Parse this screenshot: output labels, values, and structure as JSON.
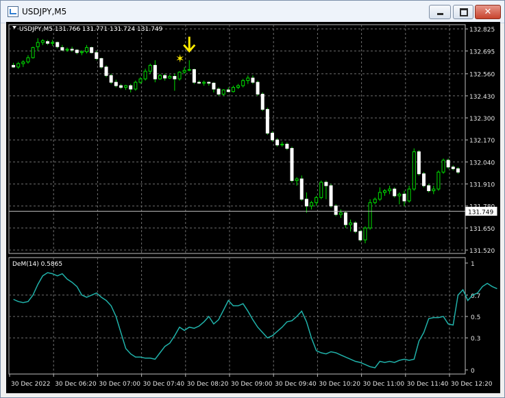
{
  "window": {
    "title": "USDJPY,M5",
    "min_icon": "minimize-icon",
    "max_icon": "maximize-icon",
    "close_icon": "close-icon",
    "close_glyph": "✕"
  },
  "chart_data": {
    "type": "candlestick",
    "header": "USDJPY,M5  131.766 131.771 131.724 131.749",
    "current_price_label": "131.749",
    "current_price": 131.749,
    "price_ylim": [
      131.5,
      132.85
    ],
    "price_ticks": [
      "132.825",
      "132.695",
      "132.560",
      "132.430",
      "132.300",
      "132.170",
      "132.040",
      "131.910",
      "131.780",
      "131.650",
      "131.520"
    ],
    "time_ticks": [
      "30 Dec 2022",
      "30 Dec 06:20",
      "30 Dec 07:00",
      "30 Dec 07:40",
      "30 Dec 08:20",
      "30 Dec 09:00",
      "30 Dec 09:40",
      "30 Dec 10:20",
      "30 Dec 11:00",
      "30 Dec 11:40",
      "30 Dec 12:20"
    ],
    "candles": [
      [
        132.61,
        132.625,
        132.595,
        132.6
      ],
      [
        132.6,
        132.63,
        132.59,
        132.62
      ],
      [
        132.62,
        132.64,
        132.6,
        132.63
      ],
      [
        132.63,
        132.67,
        132.62,
        132.655
      ],
      [
        132.655,
        132.72,
        132.65,
        132.715
      ],
      [
        132.72,
        132.77,
        132.695,
        132.745
      ],
      [
        132.745,
        132.765,
        132.73,
        132.755
      ],
      [
        132.75,
        132.76,
        132.73,
        132.74
      ],
      [
        132.74,
        132.76,
        132.725,
        132.745
      ],
      [
        132.745,
        132.75,
        132.71,
        132.72
      ],
      [
        132.715,
        132.73,
        132.695,
        132.7
      ],
      [
        132.7,
        132.715,
        132.69,
        132.705
      ],
      [
        132.705,
        132.72,
        132.69,
        132.7
      ],
      [
        132.7,
        132.705,
        132.675,
        132.685
      ],
      [
        132.685,
        132.7,
        132.67,
        132.69
      ],
      [
        132.69,
        132.73,
        132.68,
        132.715
      ],
      [
        132.715,
        132.72,
        132.68,
        132.685
      ],
      [
        132.685,
        132.695,
        132.64,
        132.65
      ],
      [
        132.65,
        132.655,
        132.59,
        132.6
      ],
      [
        132.6,
        132.61,
        132.54,
        132.55
      ],
      [
        132.55,
        132.56,
        132.5,
        132.51
      ],
      [
        132.51,
        132.525,
        132.48,
        132.49
      ],
      [
        132.49,
        132.5,
        132.47,
        132.48
      ],
      [
        132.48,
        132.495,
        132.465,
        132.49
      ],
      [
        132.49,
        132.5,
        132.45,
        132.47
      ],
      [
        132.47,
        132.52,
        132.46,
        132.51
      ],
      [
        132.51,
        132.54,
        132.5,
        132.53
      ],
      [
        132.53,
        132.59,
        132.52,
        132.575
      ],
      [
        132.575,
        132.62,
        132.56,
        132.61
      ],
      [
        132.61,
        132.64,
        132.51,
        132.53
      ],
      [
        132.53,
        132.56,
        132.525,
        132.55
      ],
      [
        132.55,
        132.56,
        132.52,
        132.535
      ],
      [
        132.535,
        132.555,
        132.53,
        132.545
      ],
      [
        132.545,
        132.56,
        132.46,
        132.53
      ],
      [
        132.53,
        132.575,
        132.52,
        132.57
      ],
      [
        132.57,
        132.6,
        132.56,
        132.58
      ],
      [
        132.58,
        132.64,
        132.575,
        132.585
      ],
      [
        132.585,
        132.59,
        132.5,
        132.51
      ],
      [
        132.51,
        132.52,
        132.5,
        132.505
      ],
      [
        132.505,
        132.52,
        132.49,
        132.51
      ],
      [
        132.51,
        132.515,
        132.49,
        132.505
      ],
      [
        132.505,
        132.51,
        132.45,
        132.47
      ],
      [
        132.47,
        132.48,
        132.43,
        132.44
      ],
      [
        132.44,
        132.47,
        132.43,
        132.465
      ],
      [
        132.465,
        132.48,
        132.45,
        132.455
      ],
      [
        132.455,
        132.49,
        132.45,
        132.48
      ],
      [
        132.48,
        132.5,
        132.47,
        132.49
      ],
      [
        132.49,
        132.53,
        132.48,
        132.52
      ],
      [
        132.52,
        132.55,
        132.5,
        132.535
      ],
      [
        132.535,
        132.55,
        132.5,
        132.51
      ],
      [
        132.51,
        132.52,
        132.43,
        132.44
      ],
      [
        132.44,
        132.45,
        132.34,
        132.35
      ],
      [
        132.35,
        132.36,
        132.2,
        132.21
      ],
      [
        132.21,
        132.22,
        132.16,
        132.17
      ],
      [
        132.17,
        132.18,
        132.13,
        132.14
      ],
      [
        132.14,
        132.16,
        132.13,
        132.145
      ],
      [
        132.145,
        132.155,
        132.11,
        132.12
      ],
      [
        132.12,
        132.13,
        131.92,
        131.93
      ],
      [
        131.93,
        131.95,
        131.9,
        131.94
      ],
      [
        131.94,
        131.96,
        131.81,
        131.82
      ],
      [
        131.82,
        131.86,
        131.74,
        131.78
      ],
      [
        131.78,
        131.81,
        131.76,
        131.8
      ],
      [
        131.8,
        131.84,
        131.78,
        131.83
      ],
      [
        131.83,
        131.93,
        131.82,
        131.92
      ],
      [
        131.92,
        131.93,
        131.82,
        131.9
      ],
      [
        131.9,
        131.91,
        131.77,
        131.78
      ],
      [
        131.78,
        131.79,
        131.72,
        131.73
      ],
      [
        131.73,
        131.76,
        131.71,
        131.74
      ],
      [
        131.74,
        131.75,
        131.65,
        131.67
      ],
      [
        131.67,
        131.7,
        131.63,
        131.68
      ],
      [
        131.68,
        131.69,
        131.62,
        131.63
      ],
      [
        131.63,
        131.64,
        131.57,
        131.58
      ],
      [
        131.58,
        131.66,
        131.56,
        131.65
      ],
      [
        131.65,
        131.82,
        131.64,
        131.8
      ],
      [
        131.8,
        131.83,
        131.79,
        131.82
      ],
      [
        131.82,
        131.89,
        131.81,
        131.86
      ],
      [
        131.86,
        131.88,
        131.84,
        131.87
      ],
      [
        131.87,
        131.9,
        131.85,
        131.88
      ],
      [
        131.88,
        131.89,
        131.83,
        131.84
      ],
      [
        131.84,
        131.86,
        131.79,
        131.85
      ],
      [
        131.85,
        131.87,
        131.78,
        131.81
      ],
      [
        131.81,
        131.9,
        131.8,
        131.88
      ],
      [
        131.88,
        132.12,
        131.87,
        132.1
      ],
      [
        132.1,
        132.11,
        131.96,
        131.97
      ],
      [
        131.97,
        131.98,
        131.89,
        131.9
      ],
      [
        131.9,
        131.91,
        131.86,
        131.87
      ],
      [
        131.87,
        131.9,
        131.85,
        131.88
      ],
      [
        131.88,
        131.99,
        131.87,
        131.98
      ],
      [
        131.98,
        132.06,
        131.97,
        132.05
      ],
      [
        132.05,
        132.06,
        132.0,
        132.01
      ],
      [
        132.01,
        132.02,
        131.99,
        132.0
      ],
      [
        132.0,
        132.01,
        131.97,
        131.98
      ]
    ],
    "dem_label": "DeM(14) 0.5865",
    "dem_ylim": [
      0,
      1
    ],
    "dem_ticks": [
      "1",
      "0.7",
      "0.5",
      "0.3",
      "0"
    ],
    "dem_values": [
      0.66,
      0.64,
      0.63,
      0.64,
      0.7,
      0.8,
      0.88,
      0.91,
      0.9,
      0.88,
      0.9,
      0.85,
      0.82,
      0.78,
      0.7,
      0.68,
      0.7,
      0.72,
      0.68,
      0.65,
      0.6,
      0.5,
      0.35,
      0.2,
      0.15,
      0.12,
      0.12,
      0.11,
      0.11,
      0.1,
      0.16,
      0.22,
      0.25,
      0.32,
      0.4,
      0.37,
      0.4,
      0.39,
      0.41,
      0.45,
      0.5,
      0.43,
      0.47,
      0.56,
      0.65,
      0.6,
      0.6,
      0.62,
      0.55,
      0.47,
      0.4,
      0.35,
      0.3,
      0.32,
      0.36,
      0.4,
      0.45,
      0.46,
      0.5,
      0.55,
      0.45,
      0.3,
      0.18,
      0.16,
      0.15,
      0.17,
      0.16,
      0.14,
      0.12,
      0.1,
      0.08,
      0.07,
      0.05,
      0.03,
      0.02,
      0.08,
      0.07,
      0.08,
      0.07,
      0.09,
      0.1,
      0.09,
      0.1,
      0.27,
      0.35,
      0.48,
      0.49,
      0.49,
      0.5,
      0.43,
      0.42,
      0.7,
      0.75,
      0.65,
      0.7,
      0.72,
      0.78,
      0.81,
      0.78,
      0.76
    ]
  }
}
